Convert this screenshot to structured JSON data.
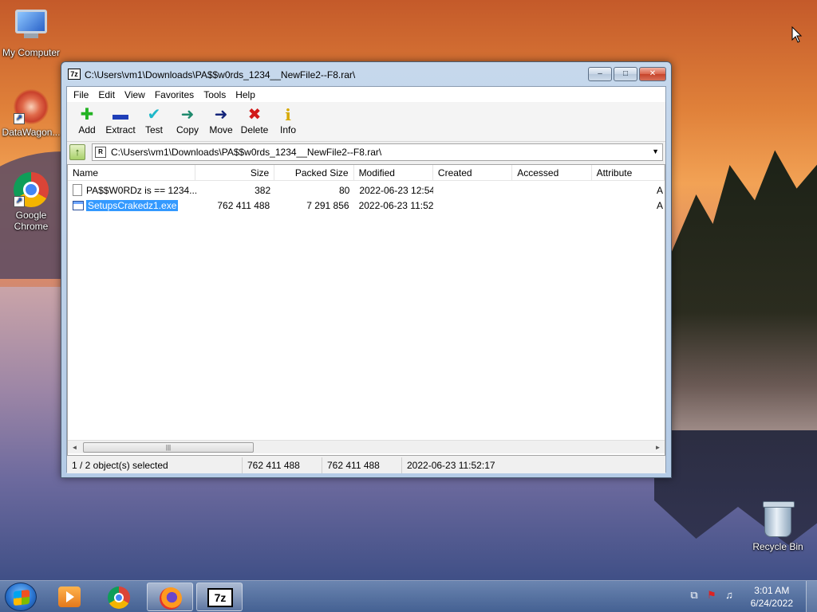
{
  "desktop": {
    "icons": [
      {
        "label": "My Computer"
      },
      {
        "label": "DataWagon..."
      },
      {
        "label": "Google Chrome"
      },
      {
        "label": "Recycle Bin"
      }
    ]
  },
  "window": {
    "title": "C:\\Users\\vm1\\Downloads\\PA$$w0rds_1234__NewFile2--F8.rar\\",
    "app_icon_text": "7z",
    "controls": {
      "minimize": "–",
      "maximize": "□",
      "close": "✕"
    },
    "menu": [
      "File",
      "Edit",
      "View",
      "Favorites",
      "Tools",
      "Help"
    ],
    "toolbar": [
      {
        "label": "Add",
        "icon": "add-icon",
        "glyph": "✚",
        "color": "#23b323"
      },
      {
        "label": "Extract",
        "icon": "extract-icon",
        "glyph": "▬",
        "color": "#1f3fb8"
      },
      {
        "label": "Test",
        "icon": "test-icon",
        "glyph": "✔",
        "color": "#1fb8c9"
      },
      {
        "label": "Copy",
        "icon": "copy-icon",
        "glyph": "➜",
        "color": "#1f8a6d"
      },
      {
        "label": "Move",
        "icon": "move-icon",
        "glyph": "➜",
        "color": "#14257a"
      },
      {
        "label": "Delete",
        "icon": "delete-icon",
        "glyph": "✖",
        "color": "#d11a1a"
      },
      {
        "label": "Info",
        "icon": "info-icon",
        "glyph": "i",
        "color": "#d6a800"
      }
    ],
    "address": {
      "up_glyph": "↑",
      "icon_text": "R",
      "path": "C:\\Users\\vm1\\Downloads\\PA$$w0rds_1234__NewFile2--F8.rar\\",
      "dropdown_glyph": "▼"
    },
    "columns": [
      "Name",
      "Size",
      "Packed Size",
      "Modified",
      "Created",
      "Accessed",
      "Attribute"
    ],
    "rows": [
      {
        "name": "PA$$W0RDz is  ==  1234...",
        "size": "382",
        "packed": "80",
        "modified": "2022-06-23 12:54",
        "created": "",
        "accessed": "",
        "attr": "A",
        "selected": false
      },
      {
        "name": "SetupsCrakedz1.exe",
        "size": "762 411 488",
        "packed": "7 291 856",
        "modified": "2022-06-23 11:52",
        "created": "",
        "accessed": "",
        "attr": "A",
        "selected": true
      }
    ],
    "scroll": {
      "left": "◄",
      "right": "►",
      "thumb": "|||"
    },
    "status": {
      "selection": "1 / 2 object(s) selected",
      "size": "762 411 488",
      "packed": "762 411 488",
      "modified": "2022-06-23 11:52:17"
    }
  },
  "taskbar": {
    "apps": [
      {
        "name": "media-player",
        "active": false
      },
      {
        "name": "chrome",
        "active": false
      },
      {
        "name": "firefox",
        "active": true
      },
      {
        "name": "7-zip",
        "active": true
      }
    ],
    "sevenz_text": "7z",
    "tray": {
      "network": "⧉",
      "flag": "⚑",
      "volume": "♫"
    },
    "clock": {
      "time": "3:01 AM",
      "date": "6/24/2022"
    }
  }
}
